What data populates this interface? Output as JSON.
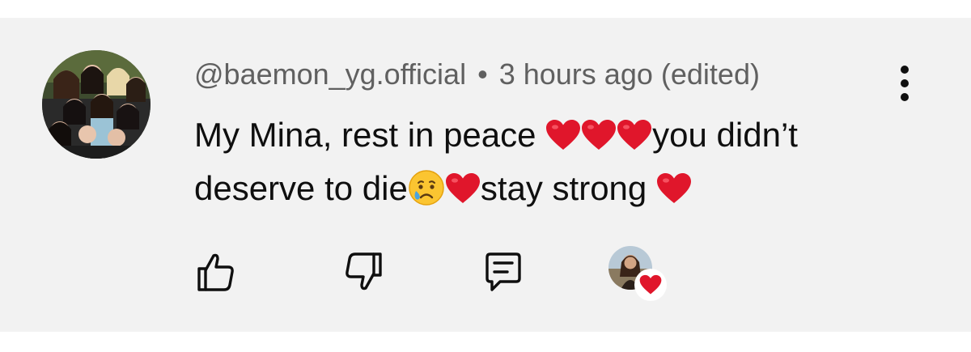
{
  "comment": {
    "author": "@baemon_yg.official",
    "separator": "•",
    "timestamp": "3 hours ago",
    "edited_label": "(edited)",
    "text_part1": "My Mina, rest in peace ",
    "text_part2": "you didn’t deserve to die",
    "text_part3": "stay strong ",
    "emoji": {
      "heart": "red-heart",
      "crying": "crying-face"
    }
  },
  "actions": {
    "like_icon": "thumbs-up-icon",
    "dislike_icon": "thumbs-down-icon",
    "reply_icon": "reply-comment-icon",
    "menu_icon": "kebab-menu-icon",
    "creator_heart_icon": "creator-heart-icon"
  },
  "colors": {
    "card_background": "#f2f2f2",
    "meta_text": "#606060",
    "body_text": "#0f0f0f",
    "heart_red": "#e0162b"
  }
}
